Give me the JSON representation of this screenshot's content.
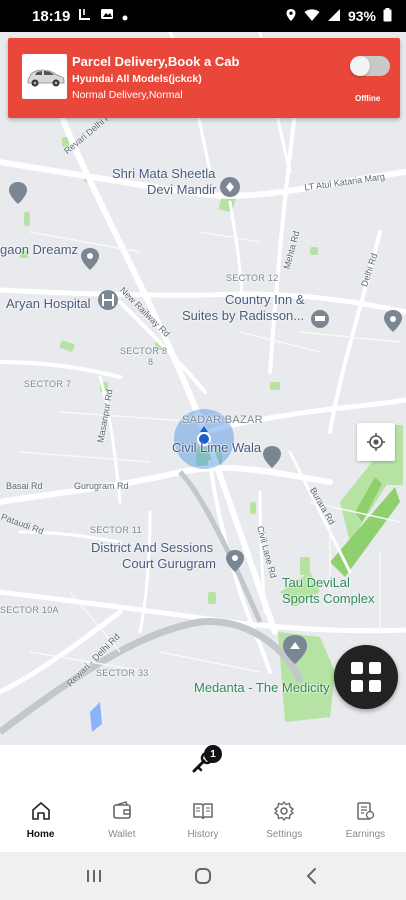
{
  "status_bar": {
    "time": "18:19",
    "battery": "93%"
  },
  "header_card": {
    "title": "Parcel Delivery,Book a Cab",
    "vehicle": "Hyundai All Models(jckck)",
    "delivery_type": "Normal Delivery,Normal",
    "online_toggle": false,
    "status_label": "Offline",
    "accent_color": "#e8473a"
  },
  "map": {
    "labels": {
      "shri_mata_line1": "Shri Mata Sheetla",
      "shri_mata_line2": "Devi Mandir",
      "aryan_hospital": "Aryan Hospital",
      "gaon_dreamz": "gaon Dreamz",
      "country_inn_line1": "Country Inn &",
      "country_inn_line2": "Suites by Radisson...",
      "sector_12": "SECTOR 12",
      "sector_8": "SECTOR 8",
      "sector_7": "SECTOR 7",
      "sector_11": "SECTOR 11",
      "sector_33": "SECTOR 33",
      "sector_10a": "SECTOR 10A",
      "sadar_bazar": "SADAR BAZAR",
      "civil_lime_wala": "Civil Lime Wala",
      "district_line1": "District And Sessions",
      "district_line2": "Court Gurugram",
      "tau_devilal_line1": "Tau DeviLal",
      "tau_devilal_line2": "Sports Complex",
      "medanta": "Medanta - The Medicity",
      "road_revari": "Revari Delhi Rd",
      "road_new_railway": "New Railway Rd",
      "road_basai": "Basai Rd",
      "road_gurugram": "Gurugram Rd",
      "road_masanpur": "Masanpur Rd",
      "road_civil_lane": "Civil Lane Rd",
      "road_burara": "Burara Rd",
      "road_delhi": "Delhi Rd",
      "road_mehta": "Mehta Rd",
      "road_lt_atul": "LT Atul Kataria Marg",
      "road_rewari": "Rewari - Delhi Rd",
      "road_pataudi": "Pataudi Rd",
      "road_8": "8"
    }
  },
  "trip_badge_count": "1",
  "bottom_nav": [
    {
      "label": "Home",
      "icon": "home-icon",
      "active": true
    },
    {
      "label": "Wallet",
      "icon": "wallet-icon",
      "active": false
    },
    {
      "label": "History",
      "icon": "history-icon",
      "active": false
    },
    {
      "label": "Settings",
      "icon": "settings-icon",
      "active": false
    },
    {
      "label": "Earnings",
      "icon": "earnings-icon",
      "active": false
    }
  ]
}
